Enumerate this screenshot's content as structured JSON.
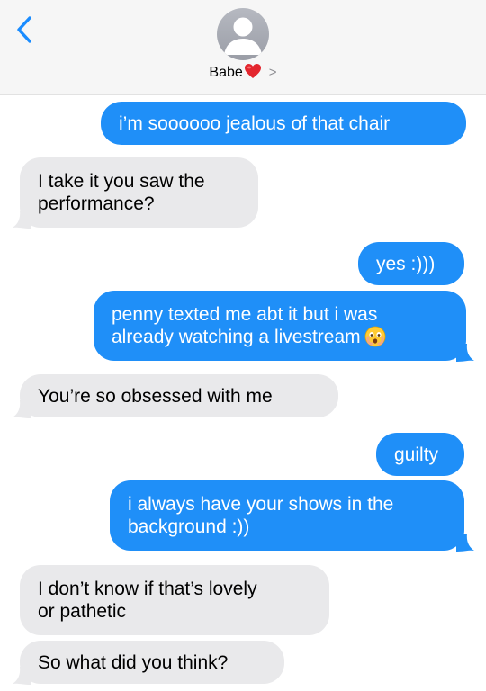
{
  "header": {
    "contact_name": "Babe",
    "heart_emoji": "red-heart",
    "chevron": ">"
  },
  "colors": {
    "outgoing": "#1f8ff8",
    "incoming": "#e9e9eb",
    "back_arrow": "#1a8cff"
  },
  "messages": [
    {
      "from": "me",
      "text": "i’m soooooo jealous of that chair"
    },
    {
      "from": "them",
      "text": "I take it you saw the\nperformance?"
    },
    {
      "from": "me",
      "text": "yes :)))"
    },
    {
      "from": "me",
      "text": "penny texted me abt it but i was\nalready watching a livestream",
      "emoji": "face-holding-back-tears"
    },
    {
      "from": "them",
      "text": "You’re so obsessed with me"
    },
    {
      "from": "me",
      "text": "guilty"
    },
    {
      "from": "me",
      "text": "i always have your shows in the\nbackground :))"
    },
    {
      "from": "them",
      "text": "I don’t know if that’s lovely\nor pathetic"
    },
    {
      "from": "them",
      "text": "So what did you think?"
    }
  ]
}
